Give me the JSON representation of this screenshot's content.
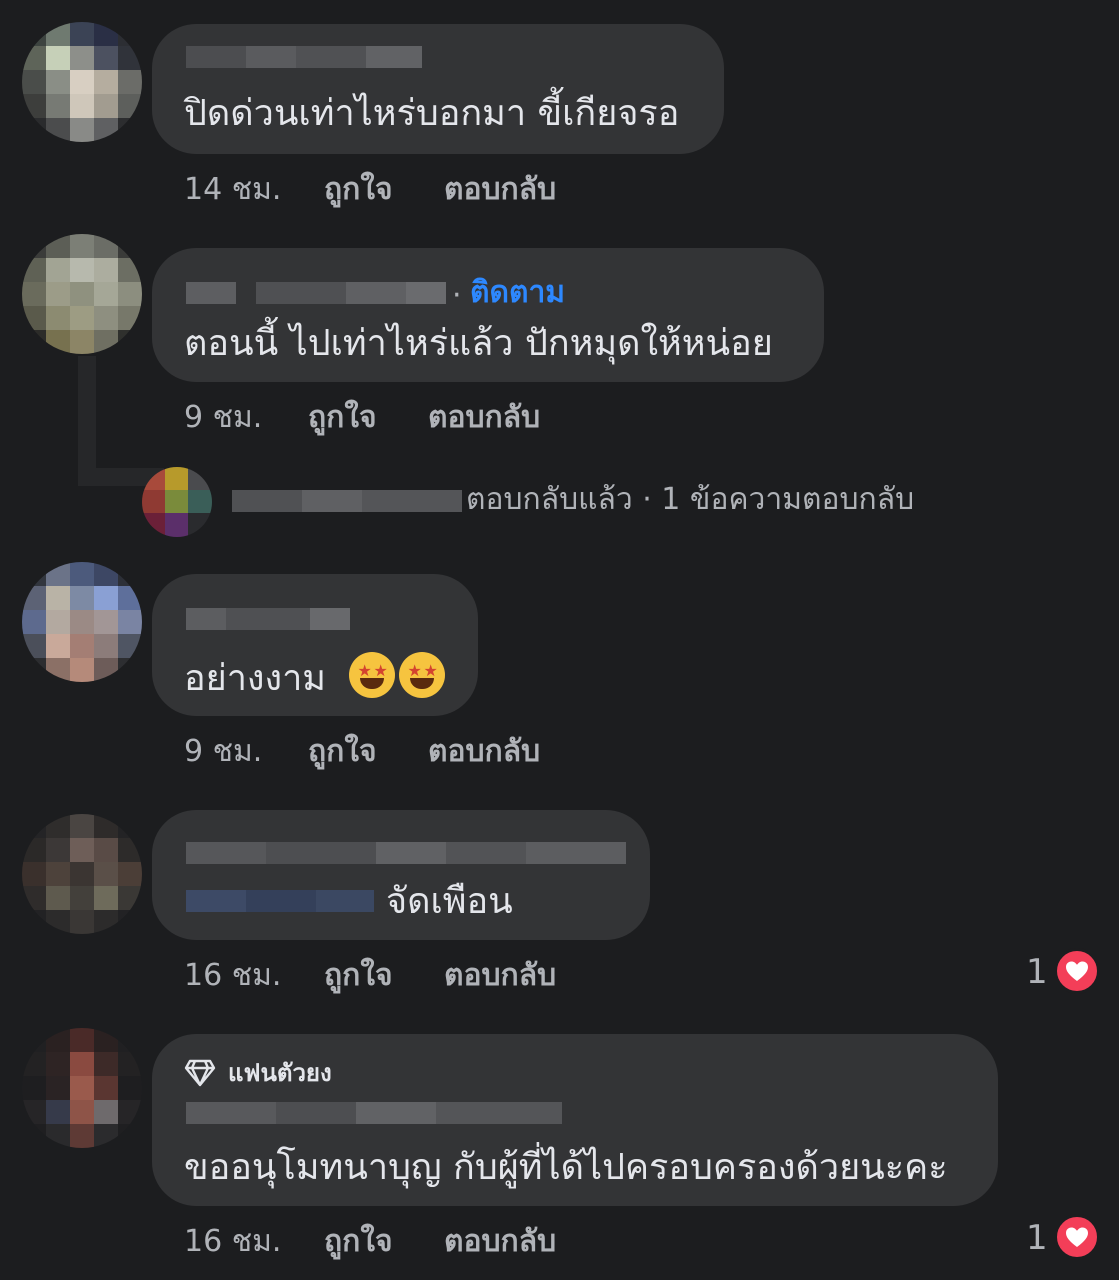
{
  "comments": [
    {
      "text": "ปิดด่วนเท่าไหร่บอกมา ขี้เกียจรอ",
      "time": "14 ชม.",
      "like_label": "ถูกใจ",
      "reply_label": "ตอบกลับ"
    },
    {
      "follow_label": "ติดตาม",
      "separator": "·",
      "text": "ตอนนี้ ไปเท่าไหร่แล้ว ปักหมุดให้หน่อย",
      "time": "9 ชม.",
      "like_label": "ถูกใจ",
      "reply_label": "ตอบกลับ",
      "replies_summary": "ตอบกลับแล้ว · 1 ข้อความตอบกลับ"
    },
    {
      "text": "อย่างงาม",
      "emoji_icon": "star-struck-emoji",
      "time": "9 ชม.",
      "like_label": "ถูกใจ",
      "reply_label": "ตอบกลับ"
    },
    {
      "text": "จัดเพือน",
      "time": "16 ชม.",
      "like_label": "ถูกใจ",
      "reply_label": "ตอบกลับ",
      "reaction_count": "1",
      "reaction_icon": "heart-reaction-icon"
    },
    {
      "badge_icon": "diamond-icon",
      "badge_label": "แฟนตัวยง",
      "text": "ขออนุโมทนาบุญ กับผู้ที่ได้ไปครอบครองด้วยนะคะ",
      "time": "16 ชม.",
      "like_label": "ถูกใจ",
      "reply_label": "ตอบกลับ",
      "reaction_count": "1",
      "reaction_icon": "heart-reaction-icon"
    }
  ],
  "colors": {
    "background": "#1c1d1f",
    "bubble": "#333436",
    "link_blue": "#2d88ff",
    "secondary_text": "#b0b3b8",
    "heart": "#f33e58"
  }
}
